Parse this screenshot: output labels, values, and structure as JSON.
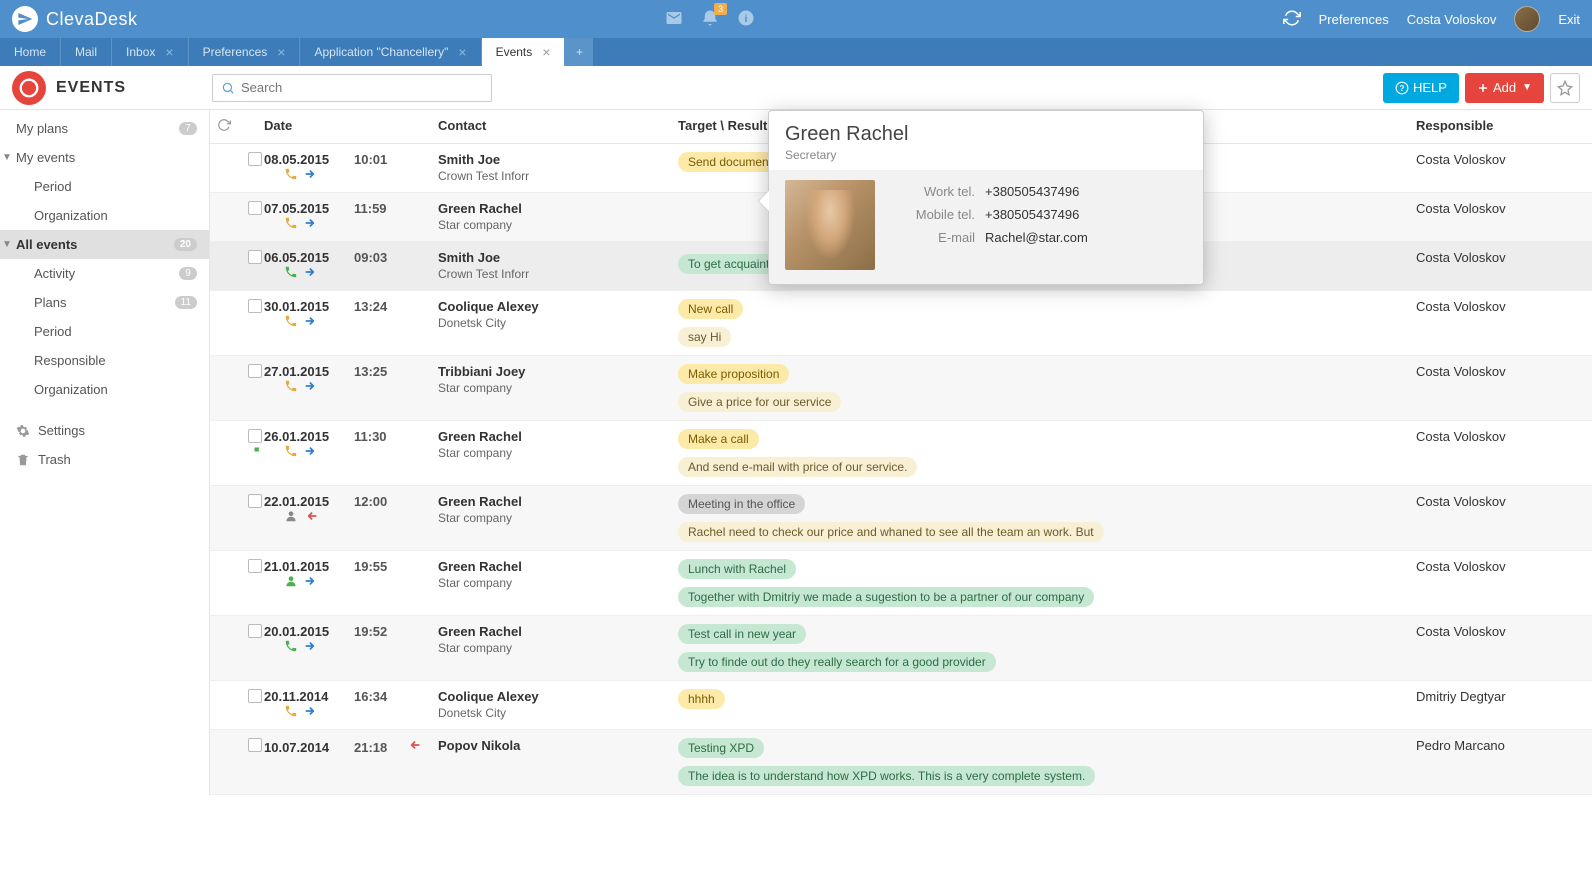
{
  "header": {
    "app_name": "ClevaDesk",
    "notif_badge": "3",
    "preferences": "Preferences",
    "username": "Costa Voloskov",
    "exit": "Exit"
  },
  "tabs": [
    {
      "label": "Home",
      "closable": false
    },
    {
      "label": "Mail",
      "closable": false
    },
    {
      "label": "Inbox",
      "closable": true
    },
    {
      "label": "Preferences",
      "closable": true
    },
    {
      "label": "Application \"Chancellery\"",
      "closable": true
    },
    {
      "label": "Events",
      "closable": true,
      "active": true
    }
  ],
  "toolbar": {
    "title": "EVENTS",
    "search_placeholder": "Search",
    "help_label": "HELP",
    "add_label": "Add"
  },
  "sidebar": {
    "items": [
      {
        "label": "My plans",
        "count": "7"
      },
      {
        "label": "My events",
        "caret": true
      },
      {
        "label": "Period",
        "sub": true
      },
      {
        "label": "Organization",
        "sub": true
      },
      {
        "label": "All events",
        "count": "20",
        "selected": true,
        "caret": true
      },
      {
        "label": "Activity",
        "sub": true,
        "count": "9"
      },
      {
        "label": "Plans",
        "sub": true,
        "count": "11"
      },
      {
        "label": "Period",
        "sub": true
      },
      {
        "label": "Responsible",
        "sub": true
      },
      {
        "label": "Organization",
        "sub": true
      }
    ],
    "settings": "Settings",
    "trash": "Trash"
  },
  "columns": {
    "date": "Date",
    "contact": "Contact",
    "target": "Target \\ Result",
    "responsible": "Responsible"
  },
  "rows": [
    {
      "date": "08.05.2015",
      "time": "10:01",
      "icon1": "phone-yellow",
      "icon2": "arrow-blue",
      "contact": "Smith Joe",
      "org": "Crown Test Inforr",
      "target": "Send document",
      "target_cls": "pill-yellow",
      "resp": "Costa Voloskov"
    },
    {
      "date": "07.05.2015",
      "time": "11:59",
      "icon1": "phone-yellow",
      "icon2": "arrow-blue",
      "contact": "Green Rachel",
      "org": "Star company",
      "resp": "Costa Voloskov",
      "alt": true
    },
    {
      "date": "06.05.2015",
      "time": "09:03",
      "icon1": "phone-green",
      "icon2": "arrow-blue",
      "contact": "Smith Joe",
      "org": "Crown Test Inforr",
      "result": "To get acquainted with Mr. Smith",
      "result_cls": "pill-green",
      "resp": "Costa Voloskov",
      "highlighted": true
    },
    {
      "date": "30.01.2015",
      "time": "13:24",
      "icon1": "phone-yellow",
      "icon2": "arrow-blue",
      "contact": "Coolique Alexey",
      "org": "Donetsk City",
      "target": "New call",
      "target_cls": "pill-yellow",
      "result": "say Hi",
      "result_cls": "pill-cream",
      "resp": "Costa Voloskov"
    },
    {
      "date": "27.01.2015",
      "time": "13:25",
      "icon1": "phone-yellow",
      "icon2": "arrow-blue",
      "contact": "Tribbiani Joey",
      "org": "Star company",
      "target": "Make proposition",
      "target_cls": "pill-yellow",
      "result": "Give a price for our service",
      "result_cls": "pill-cream",
      "resp": "Costa Voloskov",
      "alt": true
    },
    {
      "date": "26.01.2015",
      "time": "11:30",
      "icon1": "phone-yellow",
      "icon2": "arrow-blue",
      "contact": "Green Rachel",
      "org": "Star company",
      "target": "Make a call",
      "target_cls": "pill-yellow",
      "result": "And send e-mail with price of our service.",
      "result_cls": "pill-cream",
      "resp": "Costa Voloskov",
      "flag": true
    },
    {
      "date": "22.01.2015",
      "time": "12:00",
      "icon1": "person-grey",
      "icon2": "arrow-red",
      "contact": "Green Rachel",
      "org": "Star company",
      "target": "Meeting in the office",
      "target_cls": "pill-grey",
      "result": "Rachel need to check our price and whaned to see all the team an work. But",
      "result_cls": "pill-cream",
      "resp": "Costa Voloskov",
      "alt": true
    },
    {
      "date": "21.01.2015",
      "time": "19:55",
      "icon1": "person-green",
      "icon2": "arrow-blue",
      "contact": "Green Rachel",
      "org": "Star company",
      "target": "Lunch with Rachel",
      "target_cls": "pill-green",
      "result": "Together with Dmitriy we made a sugestion to be a partner of our company",
      "result_cls": "pill-green",
      "resp": "Costa Voloskov"
    },
    {
      "date": "20.01.2015",
      "time": "19:52",
      "icon1": "phone-green",
      "icon2": "arrow-blue",
      "contact": "Green Rachel",
      "org": "Star company",
      "target": "Test call in new year",
      "target_cls": "pill-green",
      "result": "Try to finde out do they really search for a good provider",
      "result_cls": "pill-green",
      "resp": "Costa Voloskov",
      "alt": true
    },
    {
      "date": "20.11.2014",
      "time": "16:34",
      "icon1": "phone-yellow",
      "icon2": "arrow-blue",
      "contact": "Coolique Alexey",
      "org": "Donetsk City",
      "target": "hhhh",
      "target_cls": "pill-yellow",
      "resp": "Dmitriy Degtyar"
    },
    {
      "date": "10.07.2014",
      "time": "21:18",
      "icon1": "none",
      "icon2": "arrow-red",
      "contact": "Popov Nikola",
      "org": "",
      "target": "Testing XPD",
      "target_cls": "pill-green",
      "result": "The idea is to understand how XPD works. This is a very complete system.",
      "result_cls": "pill-green",
      "resp": "Pedro Marcano",
      "alt": true
    }
  ],
  "popover": {
    "name": "Green Rachel",
    "role": "Secretary",
    "fields": [
      {
        "label": "Work tel.",
        "value": "+380505437496"
      },
      {
        "label": "Mobile tel.",
        "value": "+380505437496"
      },
      {
        "label": "E-mail",
        "value": "Rachel@star.com"
      }
    ]
  }
}
